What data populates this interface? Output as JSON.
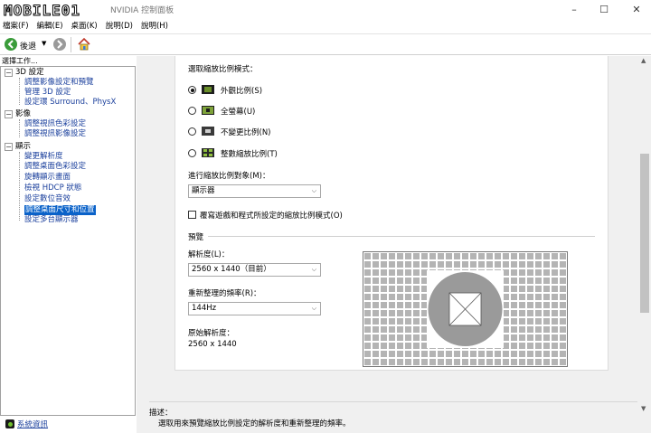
{
  "window": {
    "logo_text": "MOBILE01",
    "title": "NVIDIA 控制面板",
    "minimize": "–",
    "maximize": "☐",
    "close": "✕"
  },
  "menu": [
    "檔案(F)",
    "編輯(E)",
    "桌面(K)",
    "說明(D)",
    "說明(H)"
  ],
  "toolbar": {
    "back_label": "後退",
    "dropdown": "▼"
  },
  "left_panel": {
    "header": "選擇工作...",
    "categories": [
      {
        "label": "3D 設定",
        "toggle": "−",
        "items": [
          "調整影像設定和預覽",
          "管理 3D 設定",
          "設定環 Surround、PhysX"
        ]
      },
      {
        "label": "影像",
        "toggle": "−",
        "items": [
          "調整視訊色彩設定",
          "調整視訊影像設定"
        ]
      },
      {
        "label": "顯示",
        "toggle": "−",
        "items": [
          "變更解析度",
          "調整桌面色彩設定",
          "旋轉顯示畫面",
          "檢視 HDCP 狀態",
          "設定數位音效",
          "調整桌面尺寸和位置",
          "設定多台顯示器"
        ]
      }
    ],
    "selected_item": "調整桌面尺寸和位置",
    "system_info": "系統資訊"
  },
  "content": {
    "scaling_mode_label": "選取縮放比例模式：",
    "modes": [
      {
        "label": "外觀比例(S)",
        "checked": true,
        "icon": "aspect-ratio-icon"
      },
      {
        "label": "全螢幕(U)",
        "checked": false,
        "icon": "fullscreen-icon"
      },
      {
        "label": "不變更比例(N)",
        "checked": false,
        "icon": "no-scaling-icon"
      },
      {
        "label": "整數縮放比例(T)",
        "checked": false,
        "icon": "integer-scaling-icon"
      }
    ],
    "scaling_target_label": "進行縮放比例對象(M)：",
    "scaling_target_value": "顯示器",
    "override_checkbox_label": "覆寫遊戲和程式所設定的縮放比例模式(O)",
    "override_checked": false,
    "preview_label": "預覽",
    "resolution_label": "解析度(L)：",
    "resolution_value": "2560 x 1440（目前）",
    "refresh_label": "重新整理的頻率(R)：",
    "refresh_value": "144Hz",
    "native_label": "原始解析度：",
    "native_value": "2560 x 1440"
  },
  "description": {
    "label": "描述：",
    "text": "選取用來預覽縮放比例設定的解析度和重新整理的頻率。"
  },
  "colors": {
    "nvidia_green": "#76b900",
    "selected_blue": "#0a62c9",
    "link_blue": "#1a3f9c"
  }
}
